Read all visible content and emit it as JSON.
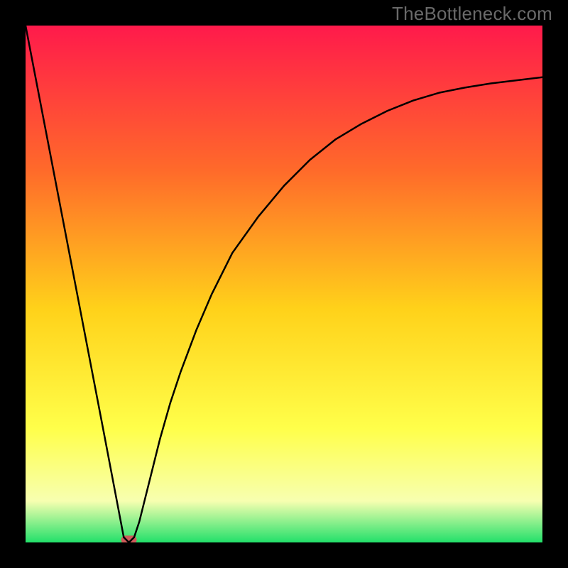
{
  "watermark": "TheBottleneck.com",
  "chart_data": {
    "type": "line",
    "title": "",
    "xlabel": "",
    "ylabel": "",
    "xlim": [
      0,
      100
    ],
    "ylim": [
      0,
      100
    ],
    "grid": false,
    "legend": false,
    "annotations": [],
    "series": [
      {
        "name": "curve",
        "x": [
          0,
          5,
          10,
          15,
          19,
          20,
          21,
          22,
          24,
          26,
          28,
          30,
          33,
          36,
          40,
          45,
          50,
          55,
          60,
          65,
          70,
          75,
          80,
          85,
          90,
          95,
          100
        ],
        "y": [
          100,
          74,
          48,
          22,
          1,
          0,
          1,
          4,
          12,
          20,
          27,
          33,
          41,
          48,
          56,
          63,
          69,
          74,
          78,
          81,
          83.5,
          85.5,
          87,
          88,
          88.8,
          89.4,
          90
        ]
      }
    ],
    "background_gradient": {
      "top": "#ff1a4b",
      "mid_upper": "#ff6a2a",
      "mid": "#ffd21a",
      "mid_lower": "#ffff4a",
      "near_bottom": "#f7ffb0",
      "bottom": "#22e06a"
    },
    "marker": {
      "x_range": [
        18.5,
        21.5
      ],
      "y": 0.5,
      "color": "#cf5a5a",
      "shape": "rounded-bar"
    },
    "curve_stroke": "#000000",
    "curve_stroke_width": 2.5
  }
}
